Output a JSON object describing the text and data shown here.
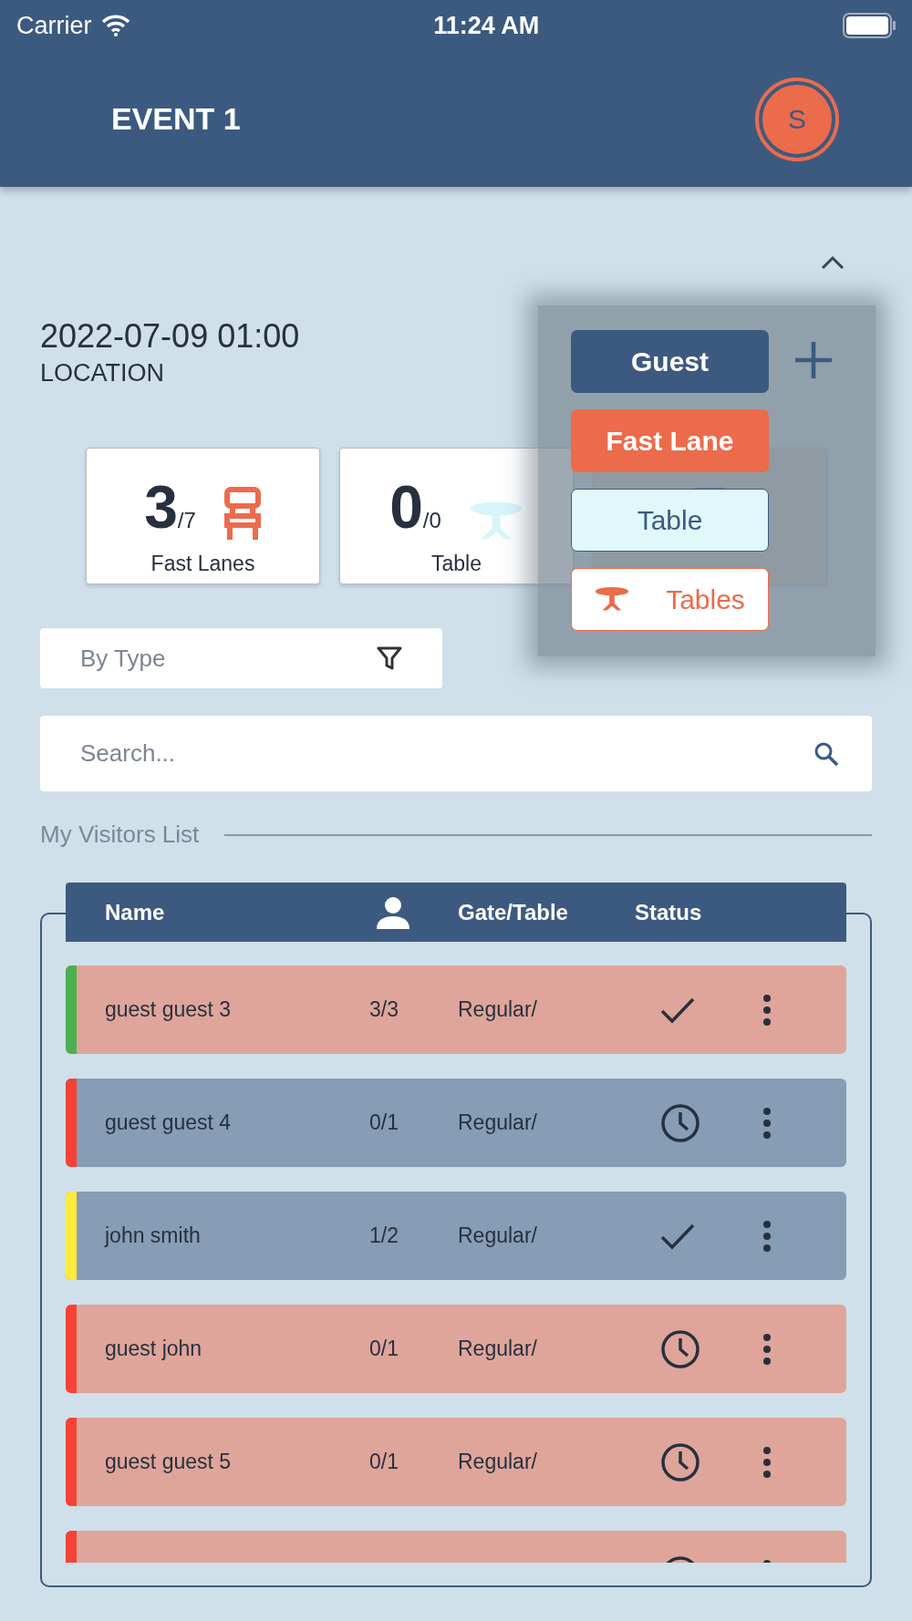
{
  "status_bar": {
    "carrier": "Carrier",
    "time": "11:24 AM"
  },
  "header": {
    "title": "EVENT 1",
    "avatar": "S"
  },
  "event": {
    "datetime": "2022-07-09 01:00",
    "location": "LOCATION"
  },
  "stats": [
    {
      "kind": "lane",
      "value": "3",
      "total": "/7",
      "label": "Fast Lanes"
    },
    {
      "kind": "table",
      "value": "0",
      "total": "/0",
      "label": "Table"
    },
    {
      "kind": "guest"
    }
  ],
  "add_menu": {
    "items": [
      {
        "kind": "primary",
        "label": "Guest"
      },
      {
        "kind": "accent",
        "label": "Fast Lane"
      },
      {
        "kind": "light",
        "label": "Table"
      },
      {
        "kind": "outline",
        "label": "Tables"
      }
    ]
  },
  "filter": {
    "placeholder": "By Type"
  },
  "search": {
    "placeholder": "Search..."
  },
  "section_title": "My Visitors List",
  "table": {
    "columns": [
      "Name",
      "Gate/Table",
      "Status"
    ],
    "rows": [
      {
        "name": "guest guest 3",
        "count": "3/3",
        "gate": "Regular/",
        "color": "#4caf50",
        "highlighted": false,
        "kind": "done"
      },
      {
        "name": "guest guest 4",
        "count": "0/1",
        "gate": "Regular/",
        "color": "#f44336",
        "highlighted": true,
        "kind": "waiting"
      },
      {
        "name": "john smith",
        "count": "1/2",
        "gate": "Regular/",
        "color": "#ffeb3b",
        "highlighted": true,
        "kind": "done"
      },
      {
        "name": "guest john",
        "count": "0/1",
        "gate": "Regular/",
        "color": "#f44336",
        "highlighted": false,
        "kind": "waiting"
      },
      {
        "name": "guest guest 5",
        "count": "0/1",
        "gate": "Regular/",
        "color": "#f44336",
        "highlighted": false,
        "kind": "waiting"
      },
      {
        "color": "#f44336",
        "highlighted": false,
        "kind": "waiting"
      }
    ]
  }
}
